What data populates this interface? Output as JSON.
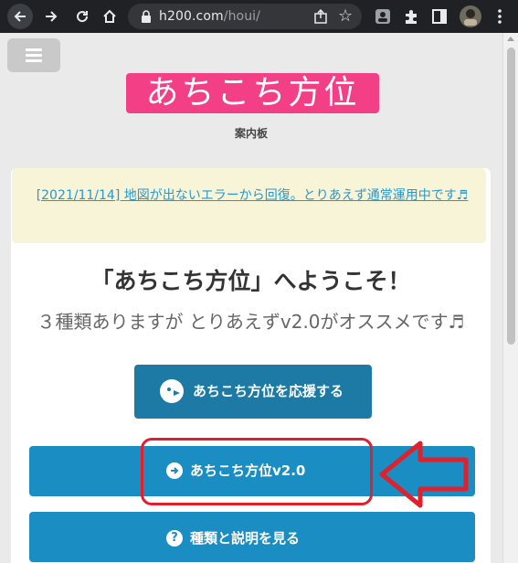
{
  "browser": {
    "url_domain": "h200.com",
    "url_path": "/houi/",
    "icons": [
      "back-icon",
      "forward-icon",
      "reload-icon",
      "home-icon",
      "lock-icon",
      "share-icon",
      "star-icon",
      "extension-icon",
      "puzzle-icon",
      "sidebar-icon",
      "profile-avatar",
      "more-icon"
    ]
  },
  "site": {
    "logo_text": "あちこち方位",
    "subtitle": "案内板",
    "notice_link": "[2021/11/14] 地図が出ないエラーから回復。とりあえず通常運用中です♬",
    "welcome": "「あちこち方位」へようこそ！",
    "description": "３種類ありますが とりあえずv2.0がオススメです♬",
    "support_button": "あちこち方位を応援する",
    "v2_button": "あちこち方位v2.0",
    "types_button": "種類と説明を見る"
  },
  "colors": {
    "logo_bg": "#f23f86",
    "button_primary": "#1a8dc2",
    "button_dark": "#1c7aa5",
    "notice_bg": "#f7f4d8",
    "annotation_red": "#e0202c"
  }
}
